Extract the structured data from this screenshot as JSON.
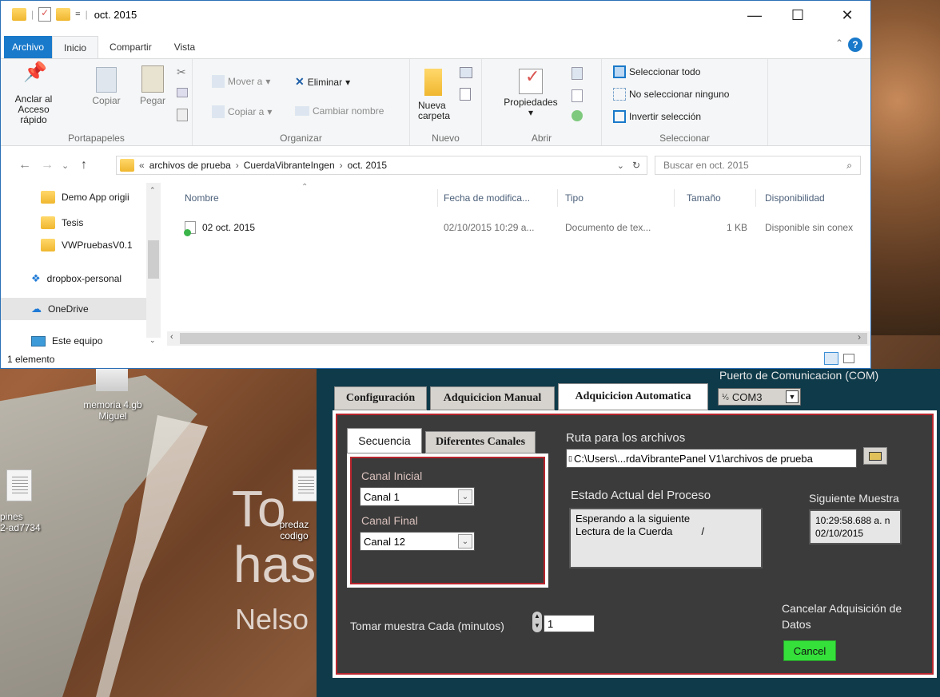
{
  "desktop": {
    "big1": "To",
    "big2": "has",
    "mid": "Nelso",
    "icon1_label_line1": "memoria 4.gb",
    "icon1_label_line2": "Miguel",
    "icon2_label_line1": "pines",
    "icon2_label_line2": "2-ad7734",
    "icon3_label_line1": "predaz",
    "icon3_label_line2": "codigo"
  },
  "explorer": {
    "title": "oct. 2015",
    "title_prefix": "=",
    "window_controls": [
      "—",
      "☐",
      "✕"
    ],
    "tabs": [
      "Archivo",
      "Inicio",
      "Compartir",
      "Vista"
    ],
    "ribbon": {
      "portapapeles": {
        "label": "Portapapeles",
        "pin_line1": "Anclar al",
        "pin_line2": "Acceso rápido",
        "copy": "Copiar",
        "paste": "Pegar"
      },
      "organizar": {
        "label": "Organizar",
        "move": "Mover a",
        "delete": "Eliminar",
        "copy_to": "Copiar a",
        "rename": "Cambiar nombre"
      },
      "nuevo": {
        "label": "Nuevo",
        "new_folder_line1": "Nueva",
        "new_folder_line2": "carpeta"
      },
      "abrir": {
        "label": "Abrir",
        "properties": "Propiedades"
      },
      "seleccionar": {
        "label": "Seleccionar",
        "select_all": "Seleccionar todo",
        "select_none": "No seleccionar ninguno",
        "invert": "Invertir selección"
      }
    },
    "address": {
      "prefix": "«",
      "crumbs": [
        "archivos de prueba",
        "CuerdaVibranteIngen",
        "oct. 2015"
      ]
    },
    "search_placeholder": "Buscar en oct. 2015",
    "nav_items": [
      {
        "label": "Demo App origii",
        "icon": "folder-icon"
      },
      {
        "label": "Tesis",
        "icon": "folder-sync-icon"
      },
      {
        "label": "VWPruebasV0.1",
        "icon": "folder-icon"
      },
      {
        "label": "dropbox-personal",
        "icon": "dropbox-icon"
      },
      {
        "label": "OneDrive",
        "icon": "onedrive-icon"
      },
      {
        "label": "Este equipo",
        "icon": "computer-icon"
      }
    ],
    "columns": [
      "Nombre",
      "Fecha de modifica...",
      "Tipo",
      "Tamaño",
      "Disponibilidad"
    ],
    "files": [
      {
        "name": "02 oct. 2015",
        "date": "02/10/2015 10:29 a...",
        "type": "Documento de tex...",
        "size": "1 KB",
        "availability": "Disponible sin conex"
      }
    ],
    "status": "1 elemento"
  },
  "lv": {
    "com_label": "Puerto de Comunicacion (COM)",
    "com_value": "COM3",
    "tabs": [
      "Configuración",
      "Adquicicion Manual",
      "Adquicicion Automatica"
    ],
    "subtabs": [
      "Secuencia",
      "Diferentes Canales"
    ],
    "canal_inicial_label": "Canal Inicial",
    "canal_inicial_value": "Canal 1",
    "canal_final_label": "Canal Final",
    "canal_final_value": "Canal 12",
    "ruta_label": "Ruta para los archivos",
    "ruta_value": "C:\\Users\\...rdaVibrantePanel V1\\archivos de prueba",
    "estado_label": "Estado Actual del Proceso",
    "estado_line1": "Esperando a la siguiente",
    "estado_line2": "Lectura de la Cuerda          /",
    "siguiente_label": "Siguiente Muestra",
    "siguiente_line1": "10:29:58.688 a. n",
    "siguiente_line2": "02/10/2015",
    "tomar_label": "Tomar muestra Cada (minutos)",
    "tomar_value": "1",
    "cancelar_label_line1": "Cancelar Adquisición de",
    "cancelar_label_line2": "Datos",
    "cancel_button": "Cancel"
  }
}
